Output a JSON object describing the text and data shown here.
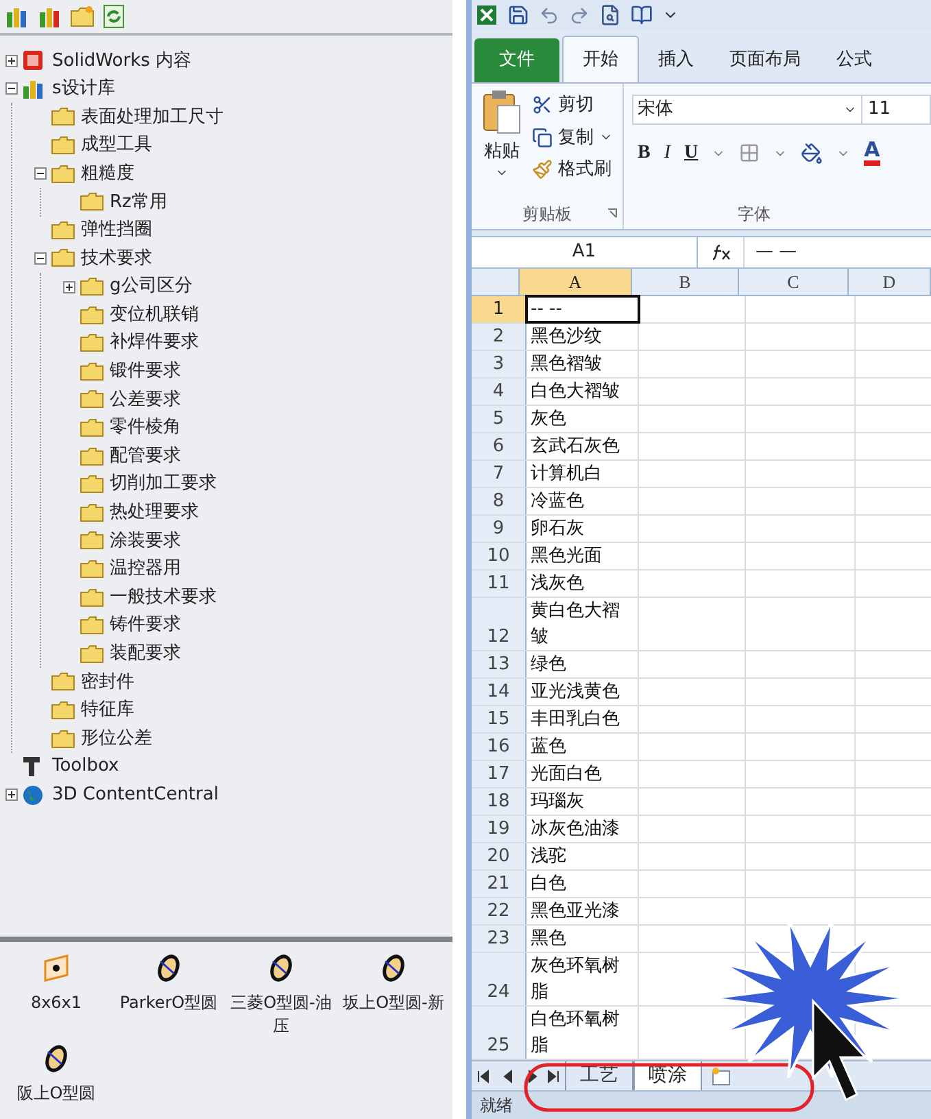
{
  "design_library": {
    "tree": [
      {
        "label": "SolidWorks 内容",
        "kind": "solidworks",
        "expanded": false
      },
      {
        "label": "s设计库",
        "kind": "library",
        "expanded": true,
        "children": [
          {
            "label": "表面处理加工尺寸",
            "kind": "folder"
          },
          {
            "label": "成型工具",
            "kind": "folder"
          },
          {
            "label": "粗糙度",
            "kind": "folder",
            "expanded": true,
            "children": [
              {
                "label": "Rz常用",
                "kind": "folder"
              }
            ]
          },
          {
            "label": "弹性挡圈",
            "kind": "folder"
          },
          {
            "label": "技术要求",
            "kind": "folder",
            "expanded": true,
            "children": [
              {
                "label": "g公司区分",
                "kind": "folder",
                "expanded": false
              },
              {
                "label": "变位机联销",
                "kind": "folder"
              },
              {
                "label": "补焊件要求",
                "kind": "folder"
              },
              {
                "label": "锻件要求",
                "kind": "folder"
              },
              {
                "label": "公差要求",
                "kind": "folder"
              },
              {
                "label": "零件棱角",
                "kind": "folder"
              },
              {
                "label": "配管要求",
                "kind": "folder"
              },
              {
                "label": "切削加工要求",
                "kind": "folder"
              },
              {
                "label": "热处理要求",
                "kind": "folder"
              },
              {
                "label": "涂装要求",
                "kind": "folder"
              },
              {
                "label": "温控器用",
                "kind": "folder"
              },
              {
                "label": "一般技术要求",
                "kind": "folder"
              },
              {
                "label": "铸件要求",
                "kind": "folder"
              },
              {
                "label": "装配要求",
                "kind": "folder"
              }
            ]
          },
          {
            "label": "密封件",
            "kind": "folder"
          },
          {
            "label": "特征库",
            "kind": "folder"
          },
          {
            "label": "形位公差",
            "kind": "folder"
          }
        ]
      },
      {
        "label": "Toolbox",
        "kind": "toolbox"
      },
      {
        "label": "3D ContentCentral",
        "kind": "globe",
        "expanded": false
      }
    ],
    "palette": [
      {
        "label": "8x6x1",
        "kind": "plate"
      },
      {
        "label": "ParkerO型圆",
        "kind": "ring"
      },
      {
        "label": "三菱O型圆-油压",
        "kind": "ring"
      },
      {
        "label": "坂上O型圆-新",
        "kind": "ring"
      },
      {
        "label": "阪上O型圆",
        "kind": "ring"
      }
    ]
  },
  "excel": {
    "ribbon_tabs": [
      {
        "label": "文件",
        "kind": "file"
      },
      {
        "label": "开始",
        "kind": "tab",
        "selected": true
      },
      {
        "label": "插入",
        "kind": "tab",
        "selected": false
      },
      {
        "label": "页面布局",
        "kind": "tab",
        "selected": false
      },
      {
        "label": "公式",
        "kind": "tab",
        "selected": false
      }
    ],
    "clipboard_group": {
      "paste": "粘贴",
      "cut": "剪切",
      "copy": "复制",
      "format_painter": "格式刷",
      "label": "剪贴板"
    },
    "font_group": {
      "font_name": "宋体",
      "font_size": "11",
      "bold": "B",
      "italic": "I",
      "underline": "U",
      "font_color": "A",
      "label": "字体"
    },
    "name_box": "A1",
    "formula": "— —",
    "columns": [
      {
        "label": "A",
        "selected": true
      },
      {
        "label": "B",
        "selected": false
      },
      {
        "label": "C",
        "selected": false
      },
      {
        "label": "D",
        "selected": false
      }
    ],
    "rows": [
      {
        "number": "1",
        "a": "-- --",
        "selected": true
      },
      {
        "number": "2",
        "a": "黑色沙纹",
        "selected": false
      },
      {
        "number": "3",
        "a": "黑色褶皱",
        "selected": false
      },
      {
        "number": "4",
        "a": "白色大褶皱",
        "selected": false
      },
      {
        "number": "5",
        "a": "灰色",
        "selected": false
      },
      {
        "number": "6",
        "a": "玄武石灰色",
        "selected": false
      },
      {
        "number": "7",
        "a": "计算机白",
        "selected": false
      },
      {
        "number": "8",
        "a": "冷蓝色",
        "selected": false
      },
      {
        "number": "9",
        "a": "卵石灰",
        "selected": false
      },
      {
        "number": "10",
        "a": "黑色光面",
        "selected": false
      },
      {
        "number": "11",
        "a": "浅灰色",
        "selected": false
      },
      {
        "number": "12",
        "a": "黄白色大褶皱",
        "selected": false
      },
      {
        "number": "13",
        "a": "绿色",
        "selected": false
      },
      {
        "number": "14",
        "a": "亚光浅黄色",
        "selected": false
      },
      {
        "number": "15",
        "a": "丰田乳白色",
        "selected": false
      },
      {
        "number": "16",
        "a": "蓝色",
        "selected": false
      },
      {
        "number": "17",
        "a": "光面白色",
        "selected": false
      },
      {
        "number": "18",
        "a": "玛瑙灰",
        "selected": false
      },
      {
        "number": "19",
        "a": "冰灰色油漆",
        "selected": false
      },
      {
        "number": "20",
        "a": "浅驼",
        "selected": false
      },
      {
        "number": "21",
        "a": "白色",
        "selected": false
      },
      {
        "number": "22",
        "a": "黑色亚光漆",
        "selected": false
      },
      {
        "number": "23",
        "a": "黑色",
        "selected": false
      },
      {
        "number": "24",
        "a": "灰色环氧树脂",
        "selected": false
      },
      {
        "number": "25",
        "a": "白色环氧树脂",
        "selected": false
      }
    ],
    "sheet_tabs": [
      {
        "label": "工艺",
        "selected": false
      },
      {
        "label": "喷涂",
        "selected": true
      }
    ],
    "status": "就绪"
  }
}
